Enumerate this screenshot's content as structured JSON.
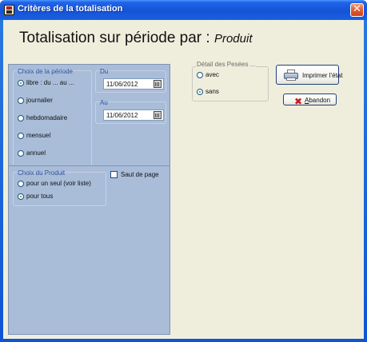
{
  "window": {
    "title": "Critères de la totalisation",
    "close_glyph": "✕"
  },
  "heading": {
    "prefix": "Totalisation sur période par : ",
    "subject": "Produit"
  },
  "periode": {
    "group_label": "Choix de la période",
    "options": [
      {
        "label": "libre : du ... au ...",
        "selected": true
      },
      {
        "label": "journalier",
        "selected": false
      },
      {
        "label": "hebdomadaire",
        "selected": false
      },
      {
        "label": "mensuel",
        "selected": false
      },
      {
        "label": "annuel",
        "selected": false
      }
    ],
    "du_label": "Du",
    "du_value": "11/06/2012",
    "au_label": "Au",
    "au_value": "11/06/2012"
  },
  "produit": {
    "group_label": "Choix du Produit",
    "options": [
      {
        "label": "pour un seul (voir liste)",
        "selected": false
      },
      {
        "label": "pour tous",
        "selected": true
      }
    ],
    "saut_de_page_label": "Saut de page",
    "saut_de_page_checked": false
  },
  "pesees": {
    "group_label": "Détail des Pesées ...",
    "options": [
      {
        "label": "avec",
        "selected": false
      },
      {
        "label": "sans",
        "selected": true
      }
    ]
  },
  "buttons": {
    "print_label": "Imprimer l'état",
    "print_icon": "printer-icon",
    "cancel_first_letter": "A",
    "cancel_rest": "bandon",
    "cancel_icon": "red-x-icon"
  },
  "colors": {
    "panel_bg": "#a9bdd9",
    "window_bg": "#efeedd",
    "titlebar": "#1553d6",
    "group_label": "#2d4f9d",
    "cancel_icon": "#d01818"
  }
}
